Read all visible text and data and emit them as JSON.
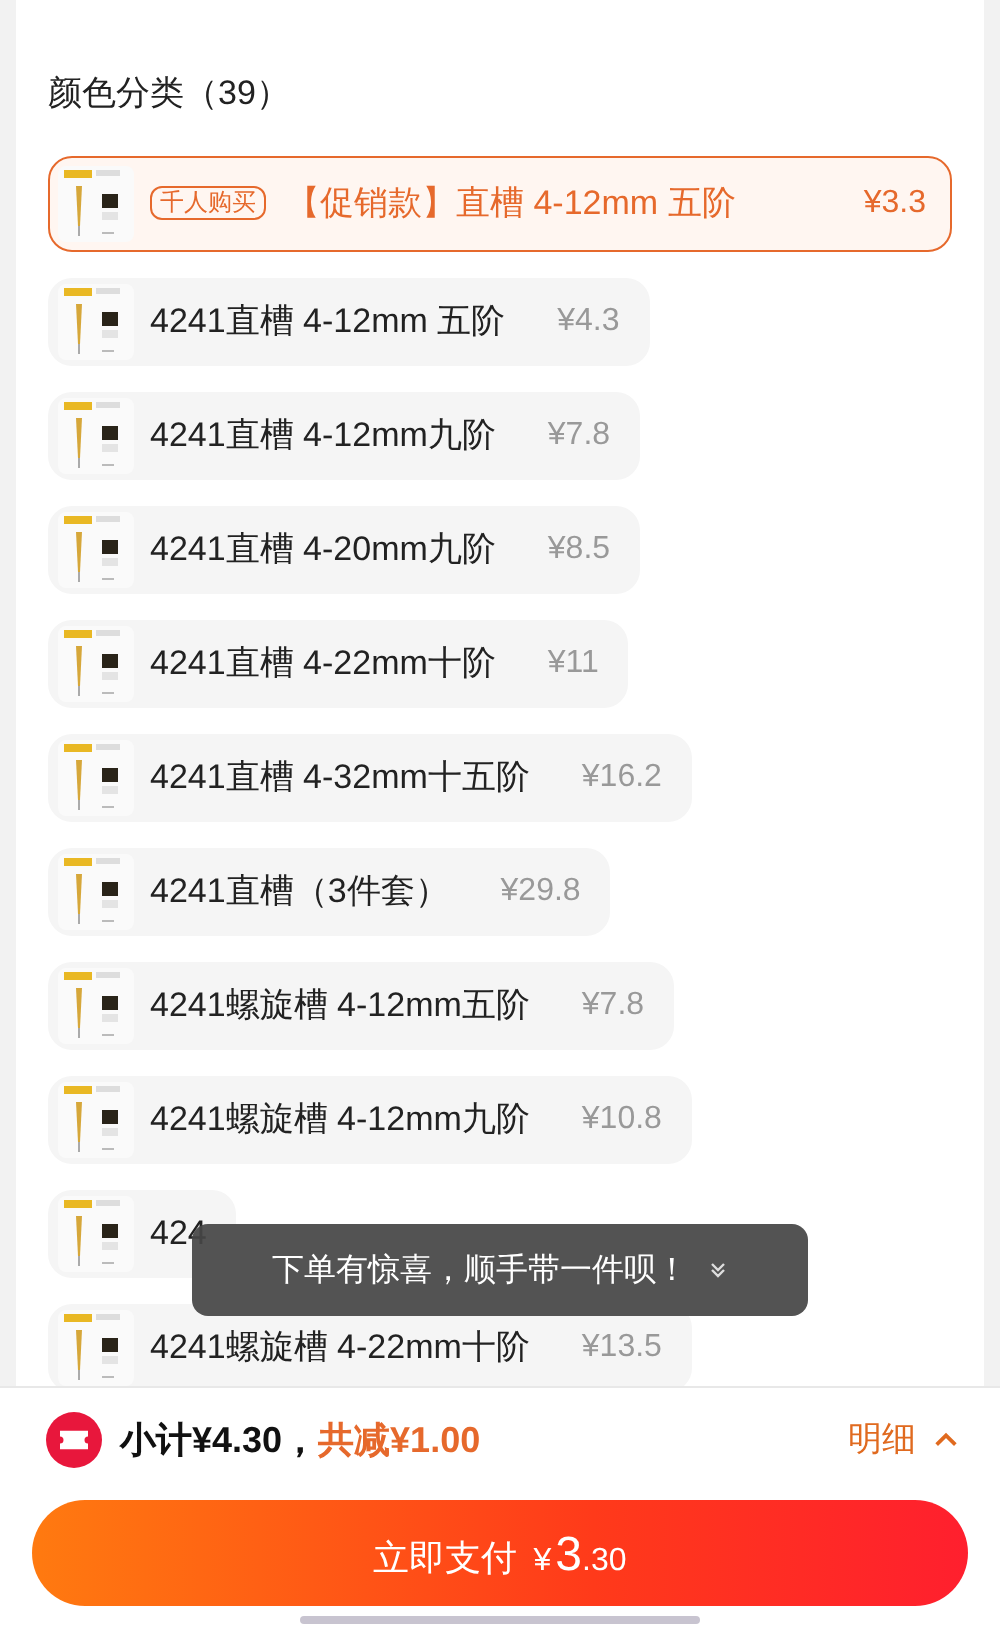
{
  "section_title": "颜色分类（39）",
  "options": [
    {
      "name": "【促销款】直槽 4-12mm 五阶",
      "price": "¥3.3",
      "badge": "千人购买",
      "selected": true
    },
    {
      "name": "4241直槽 4-12mm 五阶",
      "price": "¥4.3",
      "selected": false
    },
    {
      "name": "4241直槽 4-12mm九阶",
      "price": "¥7.8",
      "selected": false
    },
    {
      "name": "4241直槽 4-20mm九阶",
      "price": "¥8.5",
      "selected": false
    },
    {
      "name": "4241直槽 4-22mm十阶",
      "price": "¥11",
      "selected": false
    },
    {
      "name": "4241直槽 4-32mm十五阶",
      "price": "¥16.2",
      "selected": false
    },
    {
      "name": "4241直槽（3件套）",
      "price": "¥29.8",
      "selected": false
    },
    {
      "name": "4241螺旋槽 4-12mm五阶",
      "price": "¥7.8",
      "selected": false
    },
    {
      "name": "4241螺旋槽 4-12mm九阶",
      "price": "¥10.8",
      "selected": false
    },
    {
      "name": "424",
      "selected": false
    },
    {
      "name": "4241螺旋槽 4-22mm十阶",
      "price": "¥13.5",
      "selected": false
    }
  ],
  "toast": "下单有惊喜，顺手带一件呗！",
  "summary": {
    "subtotal": "小计¥4.30，",
    "discount": "共减¥1.00",
    "details_link": "明细"
  },
  "pay_button": {
    "label": "立即支付",
    "currency": "¥",
    "integer": "3",
    "decimal": ".30"
  }
}
